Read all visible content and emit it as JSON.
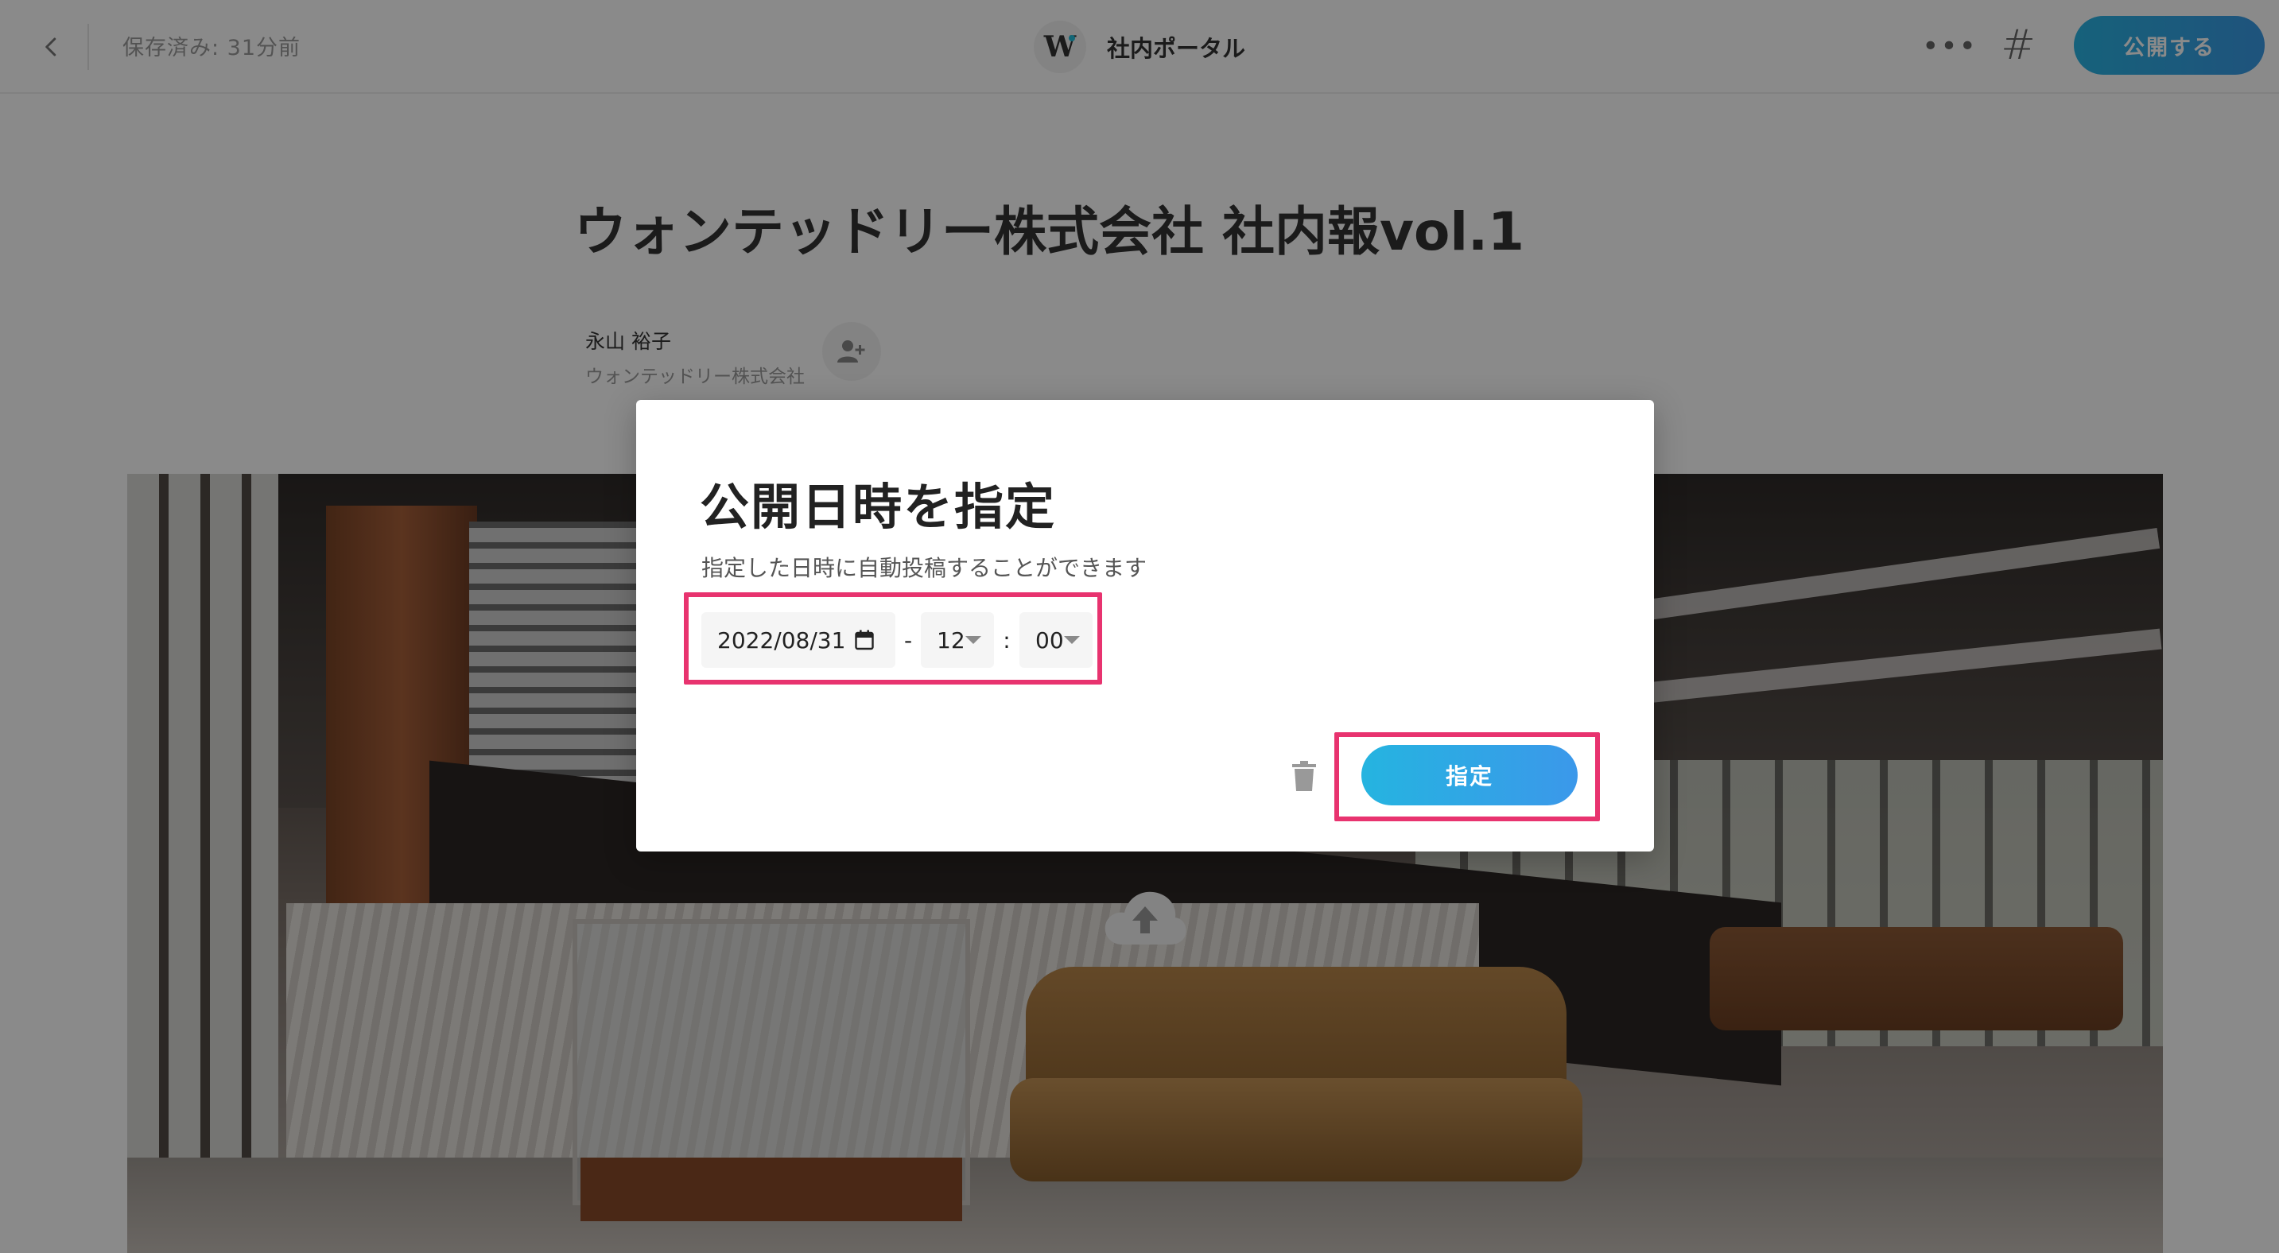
{
  "header": {
    "save_status": "保存済み: 31分前",
    "brand_logo_letter": "W",
    "brand_name": "社内ポータル",
    "more_label": "•••",
    "hash_label": "#",
    "publish_label": "公開する"
  },
  "article": {
    "title": "ウォンテッドリー株式会社 社内報vol.1",
    "author_name": "永山 裕子",
    "author_company": "ウォンテッドリー株式会社"
  },
  "modal": {
    "title": "公開日時を指定",
    "description": "指定した日時に自動投稿することができます",
    "date_value": "2022/08/31",
    "date_time_separator": "-",
    "hour_value": "12",
    "time_separator": ":",
    "minute_value": "00",
    "confirm_label": "指定"
  },
  "colors": {
    "accent_start": "#25b4e0",
    "accent_end": "#3b98ea",
    "highlight": "#e8336f",
    "overlay": "rgba(0,0,0,0.46)"
  },
  "icons": {
    "back": "chevron-left-icon",
    "more": "ellipsis-icon",
    "hash": "hashtag-icon",
    "add_author": "user-plus-icon",
    "calendar": "calendar-icon",
    "caret": "caret-down-icon",
    "trash": "trash-icon",
    "upload": "cloud-upload-icon"
  }
}
